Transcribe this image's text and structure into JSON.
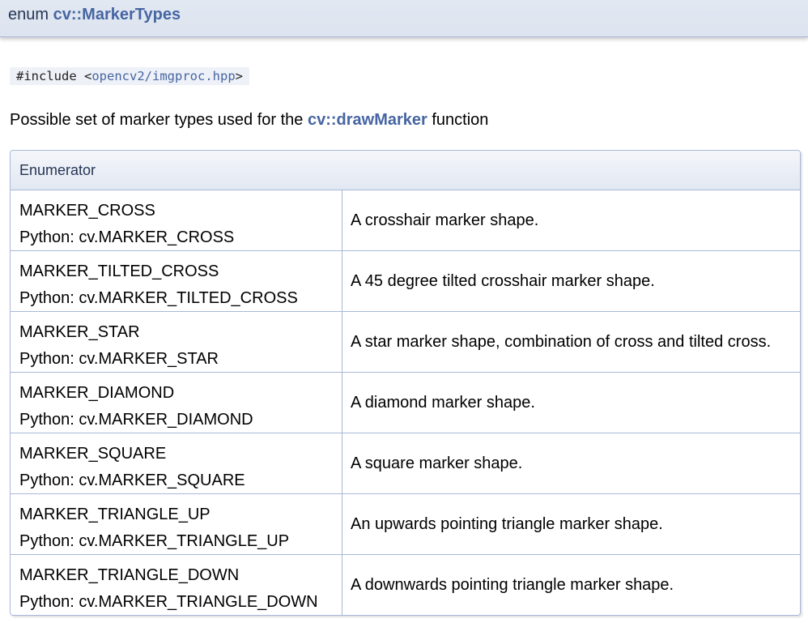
{
  "header": {
    "keyword": "enum ",
    "name": "cv::MarkerTypes"
  },
  "include": {
    "directive": "#include ",
    "open": "<",
    "path": "opencv2/imgproc.hpp",
    "close": ">"
  },
  "description": {
    "before": "Possible set of marker types used for the ",
    "link": "cv::drawMarker",
    "after": " function"
  },
  "table": {
    "header": "Enumerator",
    "rows": [
      {
        "name": "MARKER_CROSS",
        "python": "Python: cv.MARKER_CROSS",
        "doc": "A crosshair marker shape."
      },
      {
        "name": "MARKER_TILTED_CROSS",
        "python": "Python: cv.MARKER_TILTED_CROSS",
        "doc": "A 45 degree tilted crosshair marker shape."
      },
      {
        "name": "MARKER_STAR",
        "python": "Python: cv.MARKER_STAR",
        "doc": "A star marker shape, combination of cross and tilted cross."
      },
      {
        "name": "MARKER_DIAMOND",
        "python": "Python: cv.MARKER_DIAMOND",
        "doc": "A diamond marker shape."
      },
      {
        "name": "MARKER_SQUARE",
        "python": "Python: cv.MARKER_SQUARE",
        "doc": "A square marker shape."
      },
      {
        "name": "MARKER_TRIANGLE_UP",
        "python": "Python: cv.MARKER_TRIANGLE_UP",
        "doc": "An upwards pointing triangle marker shape."
      },
      {
        "name": "MARKER_TRIANGLE_DOWN",
        "python": "Python: cv.MARKER_TRIANGLE_DOWN",
        "doc": "A downwards pointing triangle marker shape."
      }
    ]
  },
  "colors": {
    "link": "#4665a2",
    "border": "#a8b8d9",
    "header_bg": "#e2e8f2"
  }
}
